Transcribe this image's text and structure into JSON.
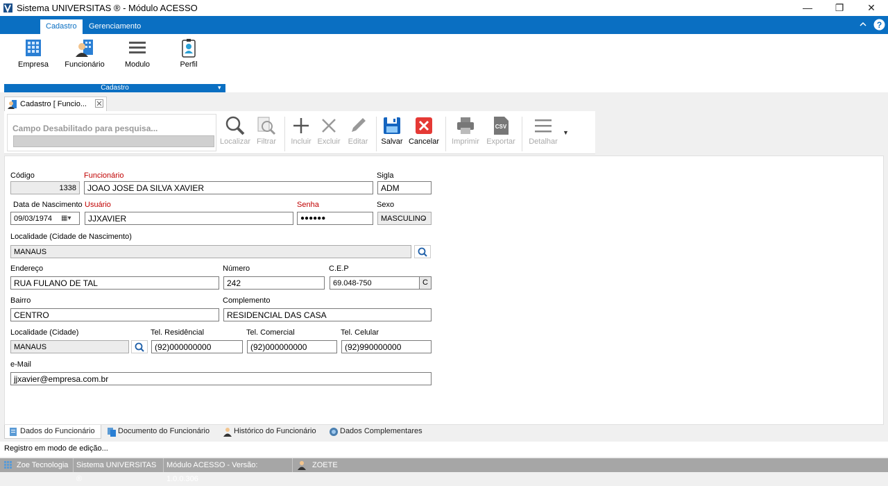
{
  "window": {
    "title": "Sistema UNIVERSITAS ® - Módulo ACESSO"
  },
  "ribbon": {
    "tabs": [
      "Cadastro",
      "Gerenciamento"
    ],
    "buttons": [
      "Empresa",
      "Funcionário",
      "Modulo",
      "Perfil"
    ],
    "group_label": "Cadastro"
  },
  "doc_tab": {
    "label": "Cadastro [ Funcio..."
  },
  "toolbar": {
    "search_placeholder": "Campo Desabilitado para pesquisa...",
    "localizar": "Localizar",
    "filtrar": "Filtrar",
    "incluir": "Incluir",
    "excluir": "Excluir",
    "editar": "Editar",
    "salvar": "Salvar",
    "cancelar": "Cancelar",
    "imprimir": "Imprimir",
    "exportar": "Exportar",
    "detalhar": "Detalhar",
    "csv_text": "CSV"
  },
  "form": {
    "codigo": {
      "label": "Código",
      "value": "1338"
    },
    "funcionario": {
      "label": "Funcionário",
      "value": "JOAO JOSE DA SILVA XAVIER"
    },
    "sigla": {
      "label": "Sigla",
      "value": "ADM"
    },
    "nascimento": {
      "label": "Data de Nascimento",
      "value": "09/03/1974"
    },
    "usuario": {
      "label": "Usuário",
      "value": "JJXAVIER"
    },
    "senha": {
      "label": "Senha",
      "value": "●●●●●●"
    },
    "sexo": {
      "label": "Sexo",
      "value": "MASCULINO"
    },
    "localidade_nasc": {
      "label": "Localidade (Cidade de Nascimento)",
      "value": "MANAUS"
    },
    "endereco": {
      "label": "Endereço",
      "value": "RUA FULANO DE TAL"
    },
    "numero": {
      "label": "Número",
      "value": "242"
    },
    "cep": {
      "label": "C.E.P",
      "value": "69.048-750",
      "button": "C"
    },
    "bairro": {
      "label": "Bairro",
      "value": "CENTRO"
    },
    "complemento": {
      "label": "Complemento",
      "value": "RESIDENCIAL DAS CASA"
    },
    "localidade": {
      "label": "Localidade (Cidade)",
      "value": "MANAUS"
    },
    "tel_res": {
      "label": "Tel. Residêncial",
      "value": "(92)000000000"
    },
    "tel_com": {
      "label": "Tel. Comercial",
      "value": "(92)000000000"
    },
    "tel_cel": {
      "label": "Tel. Celular",
      "value": "(92)990000000"
    },
    "email": {
      "label": "e-Mail",
      "value": "jjxavier@empresa.com.br"
    }
  },
  "bottom_tabs": [
    "Dados do Funcionário",
    "Documento do Funcionário",
    "Histórico do Funcionário",
    "Dados Complementares"
  ],
  "status_message": "Registro em modo de edição...",
  "status_bar": [
    "Zoe Tecnologia",
    "Sistema UNIVERSITAS ®",
    "Módulo ACESSO - Versão: 1.0.0.306",
    "ZOETE"
  ]
}
